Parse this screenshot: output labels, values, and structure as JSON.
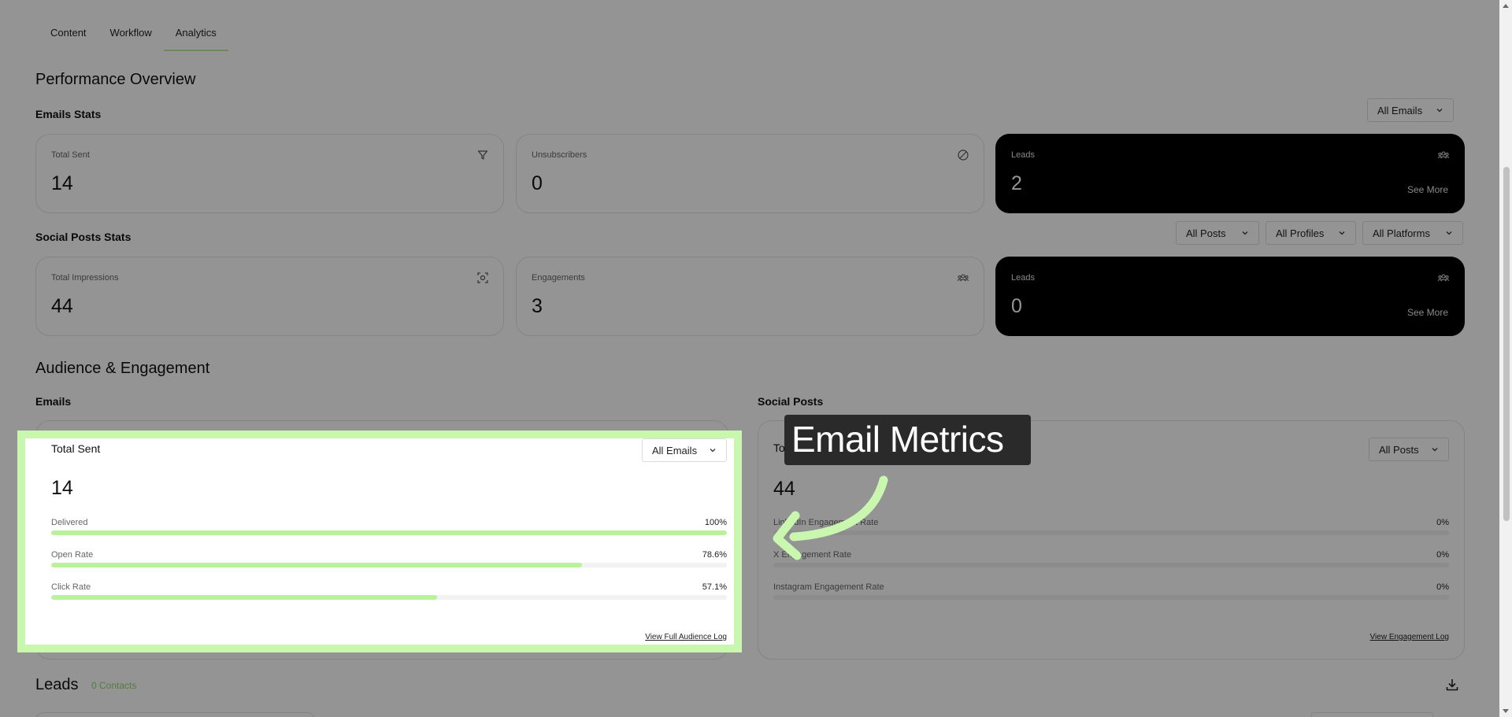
{
  "tabs": [
    {
      "label": "Content"
    },
    {
      "label": "Workflow"
    },
    {
      "label": "Analytics",
      "active": true
    }
  ],
  "performance": {
    "title": "Performance Overview",
    "emails_stats": {
      "title": "Emails Stats",
      "filter": "All Emails",
      "cards": [
        {
          "label": "Total Sent",
          "value": "14",
          "icon": "filter-icon"
        },
        {
          "label": "Unsubscribers",
          "value": "0",
          "icon": "prohibited-icon"
        },
        {
          "label": "Leads",
          "value": "2",
          "icon": "people-icon",
          "link": "See More"
        }
      ]
    },
    "social_stats": {
      "title": "Social Posts Stats",
      "filters": [
        "All Posts",
        "All Profiles",
        "All Platforms"
      ],
      "cards": [
        {
          "label": "Total Impressions",
          "value": "44",
          "icon": "focus-icon"
        },
        {
          "label": "Engagements",
          "value": "3",
          "icon": "people-icon"
        },
        {
          "label": "Leads",
          "value": "0",
          "icon": "people-icon",
          "link": "See More"
        }
      ]
    }
  },
  "audience": {
    "title": "Audience & Engagement",
    "emails": {
      "heading": "Emails",
      "panel_title": "Total Sent",
      "filter": "All Emails",
      "value": "14",
      "metrics": [
        {
          "label": "Delivered",
          "pct": "100%",
          "fraction": 1.0
        },
        {
          "label": "Open Rate",
          "pct": "78.6%",
          "fraction": 0.786
        },
        {
          "label": "Click Rate",
          "pct": "57.1%",
          "fraction": 0.571
        }
      ],
      "link": "View Full Audience Log"
    },
    "social": {
      "heading": "Social Posts",
      "panel_title": "Tot",
      "filter": "All Posts",
      "value": "44",
      "metrics": [
        {
          "label": "LinkedIn Engagement Rate",
          "pct": "0%",
          "fraction": 0
        },
        {
          "label": "X Engagement Rate",
          "pct": "0%",
          "fraction": 0
        },
        {
          "label": "Instagram Engagement Rate",
          "pct": "0%",
          "fraction": 0
        }
      ],
      "link": "View Engagement Log"
    }
  },
  "callout": {
    "text": "Email Metrics"
  },
  "leads": {
    "title": "Leads",
    "count": "0 Contacts"
  },
  "colors": {
    "accent": "#b9f29a",
    "highlight": "#c9f7b0",
    "dark_card": "#000000"
  }
}
